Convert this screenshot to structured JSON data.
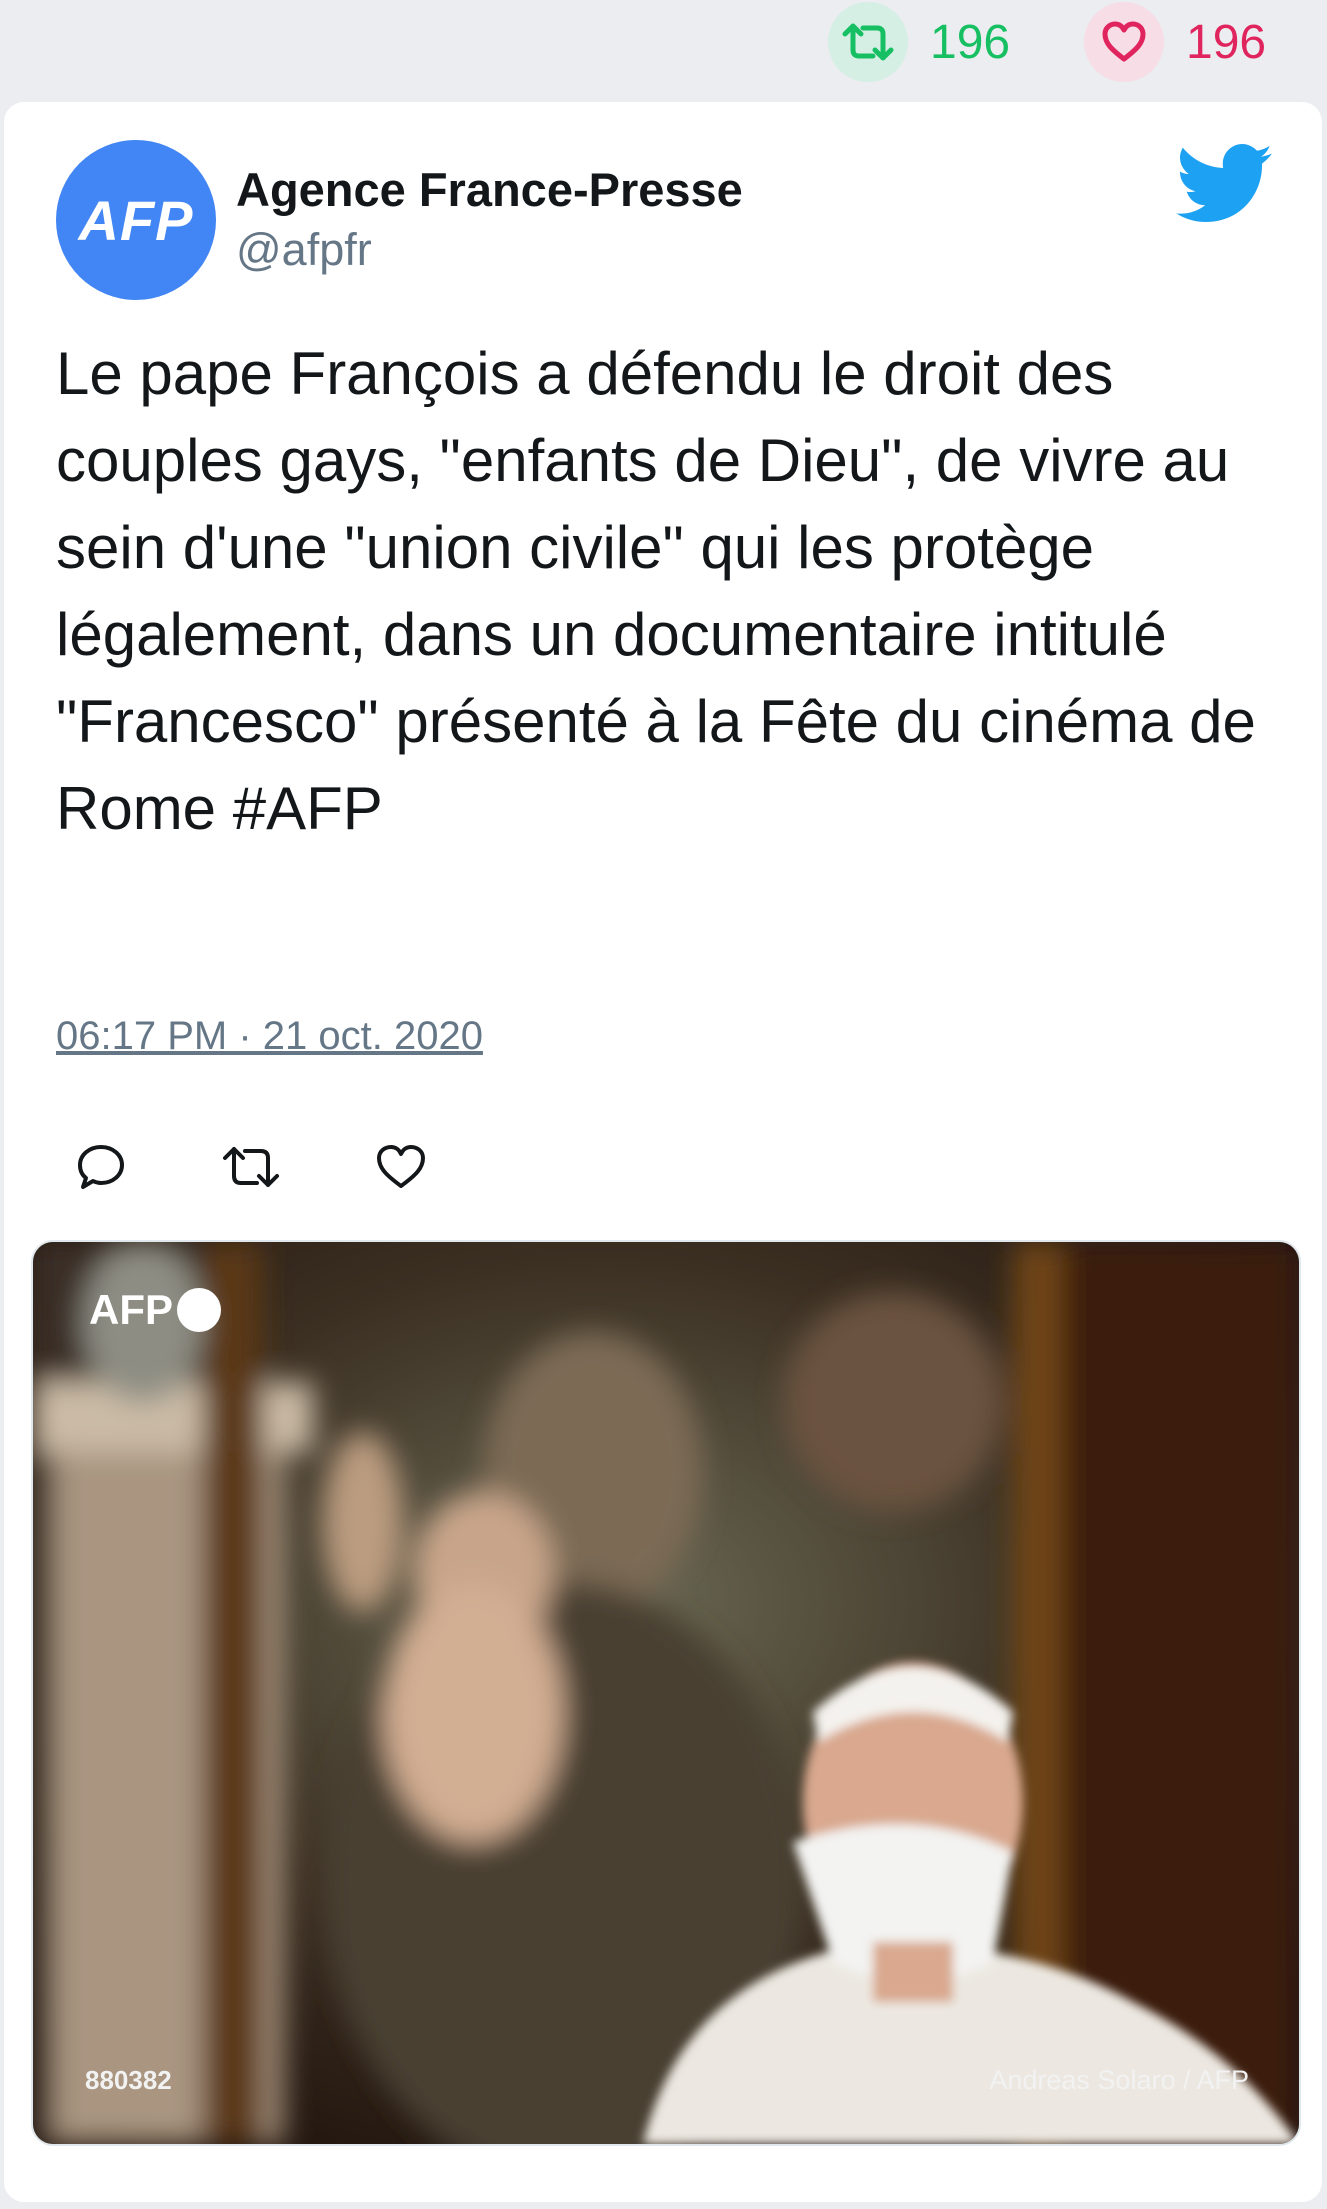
{
  "stats": {
    "retweets": "196",
    "likes": "196"
  },
  "tweet": {
    "author_name": "Agence France-Presse",
    "author_handle": "@afpfr",
    "avatar_text": "AFP",
    "text": "Le pape François a défendu le droit des couples gays, \"enfants de Dieu\", de vivre au sein d'une \"union civile\" qui les protège légalement, dans un documentaire intitulé \"Francesco\" présenté à la Fête du cinéma de Rome #AFP",
    "timestamp": "06:17 PM · 21 oct. 2020"
  },
  "media": {
    "watermark": "AFP",
    "image_id": "880382",
    "credit": "Andreas Solaro / AFP"
  },
  "icons": {
    "retweet": "retweet-icon",
    "like": "heart-icon",
    "reply": "reply-icon",
    "brand": "twitter-bird-icon"
  },
  "colors": {
    "retweet": "#17bf63",
    "like": "#e0245e",
    "avatar": "#4285f4",
    "twitter_blue": "#1da1f2",
    "muted": "#657786"
  }
}
